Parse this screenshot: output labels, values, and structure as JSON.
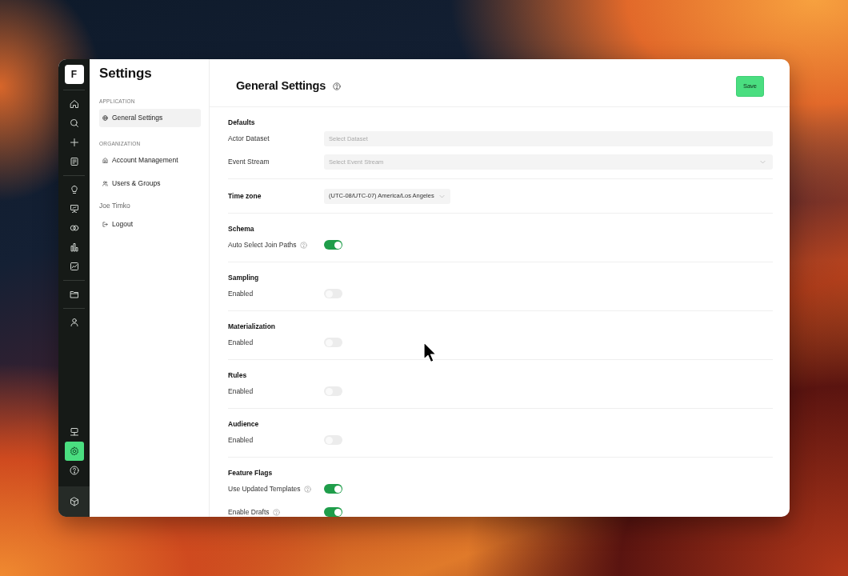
{
  "rail": {
    "logo": "F",
    "groups": [
      [
        {
          "selected": false
        },
        {
          "selected": false
        },
        {
          "selected": false
        },
        {
          "selected": false
        }
      ],
      [
        {
          "selected": false
        },
        {
          "selected": false
        },
        {
          "selected": false
        },
        {
          "selected": false
        },
        {
          "selected": false
        }
      ],
      [
        {
          "selected": false
        }
      ],
      [
        {
          "selected": false
        }
      ]
    ],
    "bottom": [
      {
        "selected": false
      },
      {
        "selected": true
      },
      {
        "selected": false
      }
    ]
  },
  "settings_nav": {
    "title": "Settings",
    "sections": [
      {
        "heading": "APPLICATION",
        "items": [
          {
            "label": "General Settings",
            "selected": true
          }
        ]
      },
      {
        "heading": "ORGANIZATION",
        "items": [
          {
            "label": "Account Management",
            "selected": false
          },
          {
            "label": "Users & Groups",
            "selected": false
          }
        ]
      }
    ],
    "user": "Joe Timko",
    "logout": "Logout"
  },
  "header": {
    "title": "General Settings",
    "save": "Save"
  },
  "sections": [
    {
      "kind": "group",
      "title": "Defaults",
      "rows": [
        {
          "kind": "input",
          "label": "Actor Dataset",
          "placeholder": "Select Dataset"
        },
        {
          "kind": "select",
          "label": "Event Stream",
          "placeholder": "Select Event Stream"
        }
      ]
    },
    {
      "kind": "inline",
      "title": "Time zone",
      "value": "(UTC-08/UTC-07) America/Los Angeles"
    },
    {
      "kind": "group",
      "title": "Schema",
      "rows": [
        {
          "kind": "toggle",
          "label": "Auto Select Join Paths",
          "help": true,
          "on": true
        }
      ]
    },
    {
      "kind": "group",
      "title": "Sampling",
      "rows": [
        {
          "kind": "toggle",
          "label": "Enabled",
          "help": false,
          "on": false
        }
      ]
    },
    {
      "kind": "group",
      "title": "Materialization",
      "rows": [
        {
          "kind": "toggle",
          "label": "Enabled",
          "help": false,
          "on": false
        }
      ]
    },
    {
      "kind": "group",
      "title": "Rules",
      "rows": [
        {
          "kind": "toggle",
          "label": "Enabled",
          "help": false,
          "on": false
        }
      ]
    },
    {
      "kind": "group",
      "title": "Audience",
      "rows": [
        {
          "kind": "toggle",
          "label": "Enabled",
          "help": false,
          "on": false
        }
      ]
    },
    {
      "kind": "group",
      "title": "Feature Flags",
      "rows": [
        {
          "kind": "toggle",
          "label": "Use Updated Templates",
          "help": true,
          "on": true
        },
        {
          "kind": "toggle",
          "label": "Enable Drafts",
          "help": true,
          "on": true
        }
      ]
    }
  ]
}
